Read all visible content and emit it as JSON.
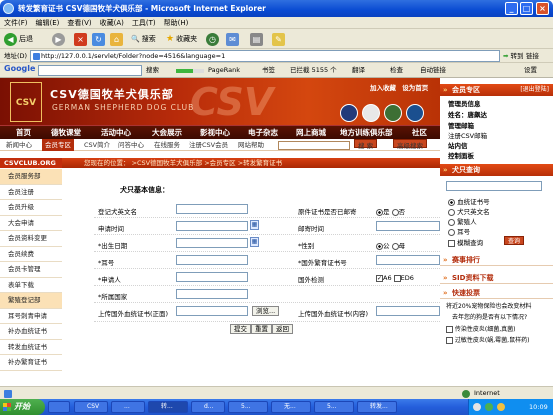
{
  "window": {
    "title": "转发繁育证书 CSV德国牧羊犬俱乐部 - Microsoft Internet Explorer"
  },
  "menu": [
    "文件(F)",
    "编辑(E)",
    "查看(V)",
    "收藏(A)",
    "工具(T)",
    "帮助(H)"
  ],
  "toolbar": {
    "back": "后退",
    "search": "搜索",
    "favorites": "收藏夹"
  },
  "address": {
    "label": "地址(D)",
    "url": "http://127.0.0.1/servlet/Folder?node=4516&language=1",
    "go": "转到",
    "links": "链接"
  },
  "googlebar": {
    "brand": "Google",
    "search": "搜索",
    "pagerank": "PageRank",
    "bookmarks": "书签",
    "blocked": "已拦截 5155 个",
    "translate": "翻译",
    "check": "检查",
    "autolink": "自动链接",
    "settings": "设置"
  },
  "site": {
    "logo": "CSV",
    "title": "CSV德国牧羊犬俱乐部",
    "subtitle": "GERMAN SHEPHERD DOG CLUB",
    "bg_text": "CSV",
    "top_links": [
      "加入收藏",
      "设为首页"
    ],
    "nav": [
      "首页",
      "德牧课堂",
      "活动中心",
      "大会展示",
      "影视中心",
      "电子杂志",
      "网上商城",
      "地方训练俱乐部",
      "社区"
    ],
    "subnav": [
      "新闻中心",
      "会员专区",
      "CSV简介",
      "问答中心",
      "在线服务",
      "注册CSV会员",
      "网站帮助"
    ],
    "search_btn": "搜 索",
    "adv_search_btn": "高级搜索",
    "breadcrumb": "您现在的位置： >CSV德国牧羊犬俱乐部 >会员专区 >转发繁育证书",
    "left_title": "CSVCLUB.ORG",
    "left_nav": [
      "会员服务部",
      "会员注册",
      "会员升级",
      "大会申请",
      "会员资料变更",
      "会员续费",
      "会员卡管理",
      "表单下载",
      "繁殖登记部",
      "耳号刺青申请",
      "补办血统证书",
      "转发血统证书",
      "补办繁育证书"
    ],
    "form": {
      "title": "犬只基本信息：",
      "rows": [
        {
          "left": "登记犬英文名",
          "right": "原件证书是否已邮寄",
          "right_opts": [
            "是",
            "否"
          ]
        },
        {
          "left": "申请时间",
          "right": "邮寄时间"
        },
        {
          "left": "*出生日期",
          "right": "*性别",
          "right_opts": [
            "公",
            "母"
          ]
        },
        {
          "left": "*耳号",
          "right": "*国外繁育证书号"
        },
        {
          "left": "*申请人",
          "right": "国外检测",
          "right_opts": [
            "A6",
            "ED6"
          ]
        },
        {
          "left": "*所属国家",
          "right": ""
        },
        {
          "left": "上传国外血统证书(正面)",
          "right": "上传国外血统证书(内容)"
        }
      ],
      "browse": "浏览...",
      "buttons": [
        "提交",
        "重置",
        "返回"
      ]
    },
    "right": {
      "member_title": "会员专区",
      "logout": "[退出登陆]",
      "member_items": [
        "管理员信息",
        "姓名：唐飙达",
        "管理邮箱",
        "注册CSV邮箱",
        "站内信",
        "控制面板"
      ],
      "dog_title": "犬只查询",
      "dog_opts": [
        "血统证书号",
        "犬只英文名",
        "繁殖人",
        "耳号",
        "模糊查询"
      ],
      "query": "查询",
      "sections": [
        "赛事排行",
        "SID资料下载",
        "快速投票"
      ],
      "vote_text": [
        "将近20%宠物保险也会改变材料",
        "去年您的狗是否有以下情况?"
      ],
      "vote_opts": [
        "传染性皮炎(细菌,真菌)",
        "过敏性皮炎(蜗,霉菌,鼠样药)"
      ]
    }
  },
  "status": {
    "text": "",
    "zone": "Internet"
  },
  "taskbar": {
    "start": "开始",
    "tasks": [
      "CSV",
      "...",
      "转...",
      "d...",
      "5...",
      "无...",
      "5...",
      "转发..."
    ],
    "time": "10:09"
  }
}
